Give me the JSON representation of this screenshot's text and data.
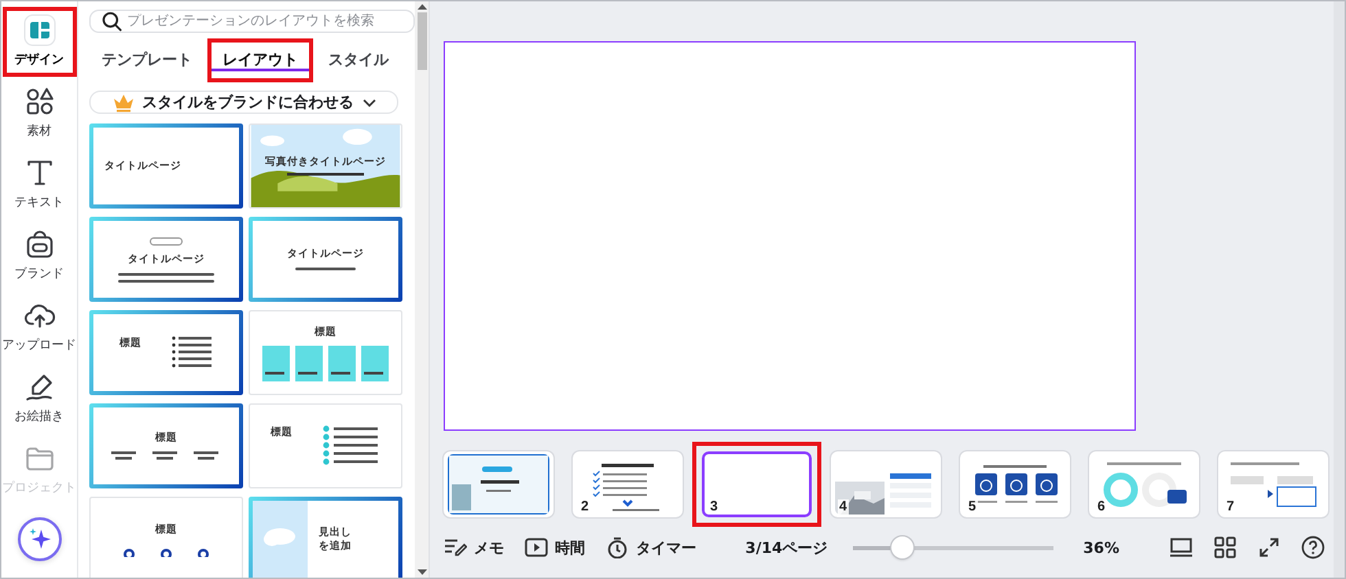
{
  "rail": {
    "items": [
      {
        "kind": "design",
        "label": "デザイン",
        "selected": true,
        "highlighted": true,
        "disabled": false
      },
      {
        "kind": "elements",
        "label": "素材",
        "selected": false,
        "highlighted": false,
        "disabled": false
      },
      {
        "kind": "text",
        "label": "テキスト",
        "selected": false,
        "highlighted": false,
        "disabled": false
      },
      {
        "kind": "brand",
        "label": "ブランド",
        "selected": false,
        "highlighted": false,
        "disabled": false
      },
      {
        "kind": "upload",
        "label": "アップロード",
        "selected": false,
        "highlighted": false,
        "disabled": false
      },
      {
        "kind": "draw",
        "label": "お絵描き",
        "selected": false,
        "highlighted": false,
        "disabled": false
      },
      {
        "kind": "projects",
        "label": "プロジェクト",
        "selected": false,
        "highlighted": false,
        "disabled": true
      }
    ]
  },
  "panel": {
    "search": {
      "placeholder": "プレゼンテーションのレイアウトを検索"
    },
    "tabs": [
      {
        "label": "テンプレート",
        "selected": false,
        "highlighted": false
      },
      {
        "label": "レイアウト",
        "selected": true,
        "highlighted": true
      },
      {
        "label": "スタイル",
        "selected": false,
        "highlighted": false
      }
    ],
    "brand_button": {
      "label": "スタイルをブランドに合わせる"
    },
    "layouts": [
      {
        "kind": "title-left",
        "title": "タイトルページ",
        "framed": true
      },
      {
        "kind": "photo-title",
        "title": "写真付きタイトルページ",
        "framed": false
      },
      {
        "kind": "title-pill",
        "title": "タイトルページ",
        "framed": true
      },
      {
        "kind": "title-sub",
        "title": "タイトルページ",
        "framed": true
      },
      {
        "kind": "bullets",
        "title": "標題",
        "framed": true
      },
      {
        "kind": "columns",
        "title": "標題",
        "framed": false
      },
      {
        "kind": "three-col",
        "title": "標題",
        "framed": true
      },
      {
        "kind": "dots",
        "title": "標題",
        "framed": false
      },
      {
        "kind": "circles",
        "title": "標題",
        "framed": false
      },
      {
        "kind": "photo-heading",
        "title": "見出しを追加",
        "framed": true
      }
    ]
  },
  "pages": [
    {
      "kind": "cover",
      "selected": false,
      "highlighted": false
    },
    {
      "kind": "checklist",
      "number": "2",
      "selected": false,
      "highlighted": false
    },
    {
      "kind": "blank",
      "number": "3",
      "selected": true,
      "highlighted": true
    },
    {
      "number": "4",
      "selected": false,
      "highlighted": false
    },
    {
      "kind": "icons",
      "number": "5",
      "selected": false,
      "highlighted": false
    },
    {
      "kind": "donut",
      "number": "6",
      "selected": false,
      "highlighted": false
    },
    {
      "kind": "flow",
      "number": "7",
      "selected": false,
      "highlighted": false
    }
  ],
  "footer": {
    "notes": "メモ",
    "duration": "時間",
    "timer": "タイマー",
    "page_indicator": "3/14ページ",
    "zoom": {
      "level": 0.25
    },
    "zoom_reading": "36%"
  }
}
